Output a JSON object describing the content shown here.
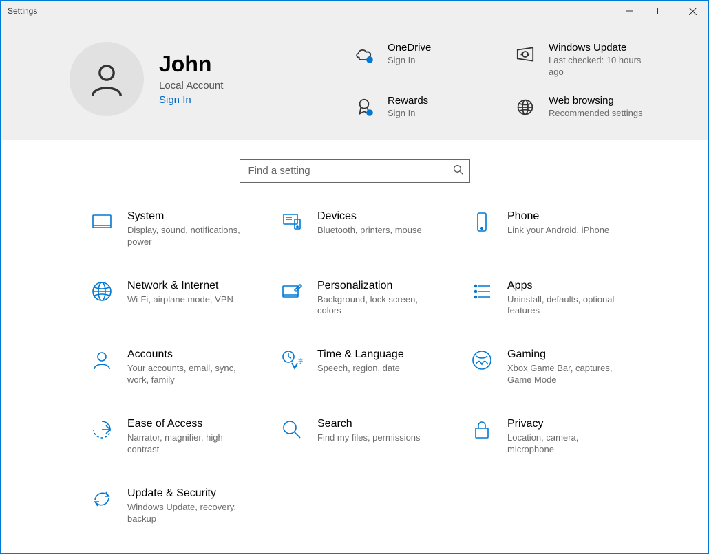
{
  "window": {
    "title": "Settings"
  },
  "profile": {
    "name": "John",
    "account_type": "Local Account",
    "signin_label": "Sign In"
  },
  "header_tiles": {
    "onedrive": {
      "title": "OneDrive",
      "subtitle": "Sign In"
    },
    "windows_update": {
      "title": "Windows Update",
      "subtitle": "Last checked: 10 hours ago"
    },
    "rewards": {
      "title": "Rewards",
      "subtitle": "Sign In"
    },
    "web_browsing": {
      "title": "Web browsing",
      "subtitle": "Recommended settings"
    }
  },
  "search": {
    "placeholder": "Find a setting"
  },
  "categories": {
    "system": {
      "title": "System",
      "subtitle": "Display, sound, notifications, power"
    },
    "devices": {
      "title": "Devices",
      "subtitle": "Bluetooth, printers, mouse"
    },
    "phone": {
      "title": "Phone",
      "subtitle": "Link your Android, iPhone"
    },
    "network": {
      "title": "Network & Internet",
      "subtitle": "Wi-Fi, airplane mode, VPN"
    },
    "personalization": {
      "title": "Personalization",
      "subtitle": "Background, lock screen, colors"
    },
    "apps": {
      "title": "Apps",
      "subtitle": "Uninstall, defaults, optional features"
    },
    "accounts": {
      "title": "Accounts",
      "subtitle": "Your accounts, email, sync, work, family"
    },
    "time": {
      "title": "Time & Language",
      "subtitle": "Speech, region, date"
    },
    "gaming": {
      "title": "Gaming",
      "subtitle": "Xbox Game Bar, captures, Game Mode"
    },
    "ease": {
      "title": "Ease of Access",
      "subtitle": "Narrator, magnifier, high contrast"
    },
    "search": {
      "title": "Search",
      "subtitle": "Find my files, permissions"
    },
    "privacy": {
      "title": "Privacy",
      "subtitle": "Location, camera, microphone"
    },
    "update": {
      "title": "Update & Security",
      "subtitle": "Windows Update, recovery, backup"
    }
  }
}
